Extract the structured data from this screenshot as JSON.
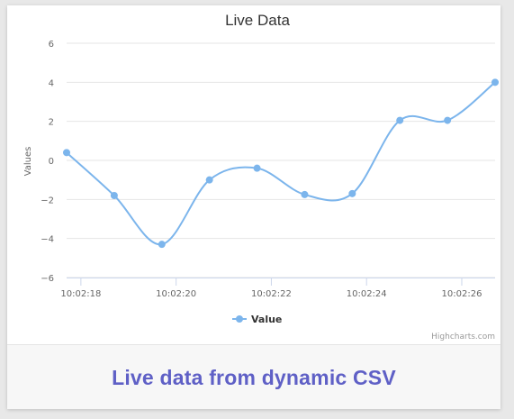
{
  "chart_data": {
    "type": "line",
    "title": "Live Data",
    "xlabel": "",
    "ylabel": "Values",
    "x": [
      "10:02:17.7",
      "10:02:18.7",
      "10:02:19.7",
      "10:02:20.7",
      "10:02:21.7",
      "10:02:22.7",
      "10:02:23.7",
      "10:02:24.7",
      "10:02:25.7",
      "10:02:26.7"
    ],
    "x_ticks": [
      "10:02:18",
      "10:02:20",
      "10:02:22",
      "10:02:24",
      "10:02:26"
    ],
    "y_ticks": [
      "6",
      "4",
      "2",
      "0",
      "−2",
      "−4",
      "−6"
    ],
    "ylim": [
      -6,
      6
    ],
    "grid": true,
    "smooth": true,
    "legend_position": "bottom-center",
    "series": [
      {
        "name": "Value",
        "color": "#7cb5ec",
        "values": [
          0.4,
          -1.8,
          -4.3,
          -1.0,
          -0.4,
          -1.75,
          -1.7,
          2.05,
          2.05,
          4.0
        ]
      }
    ]
  },
  "credits": "Highcharts.com",
  "footer": {
    "caption": "Live data from dynamic CSV"
  }
}
